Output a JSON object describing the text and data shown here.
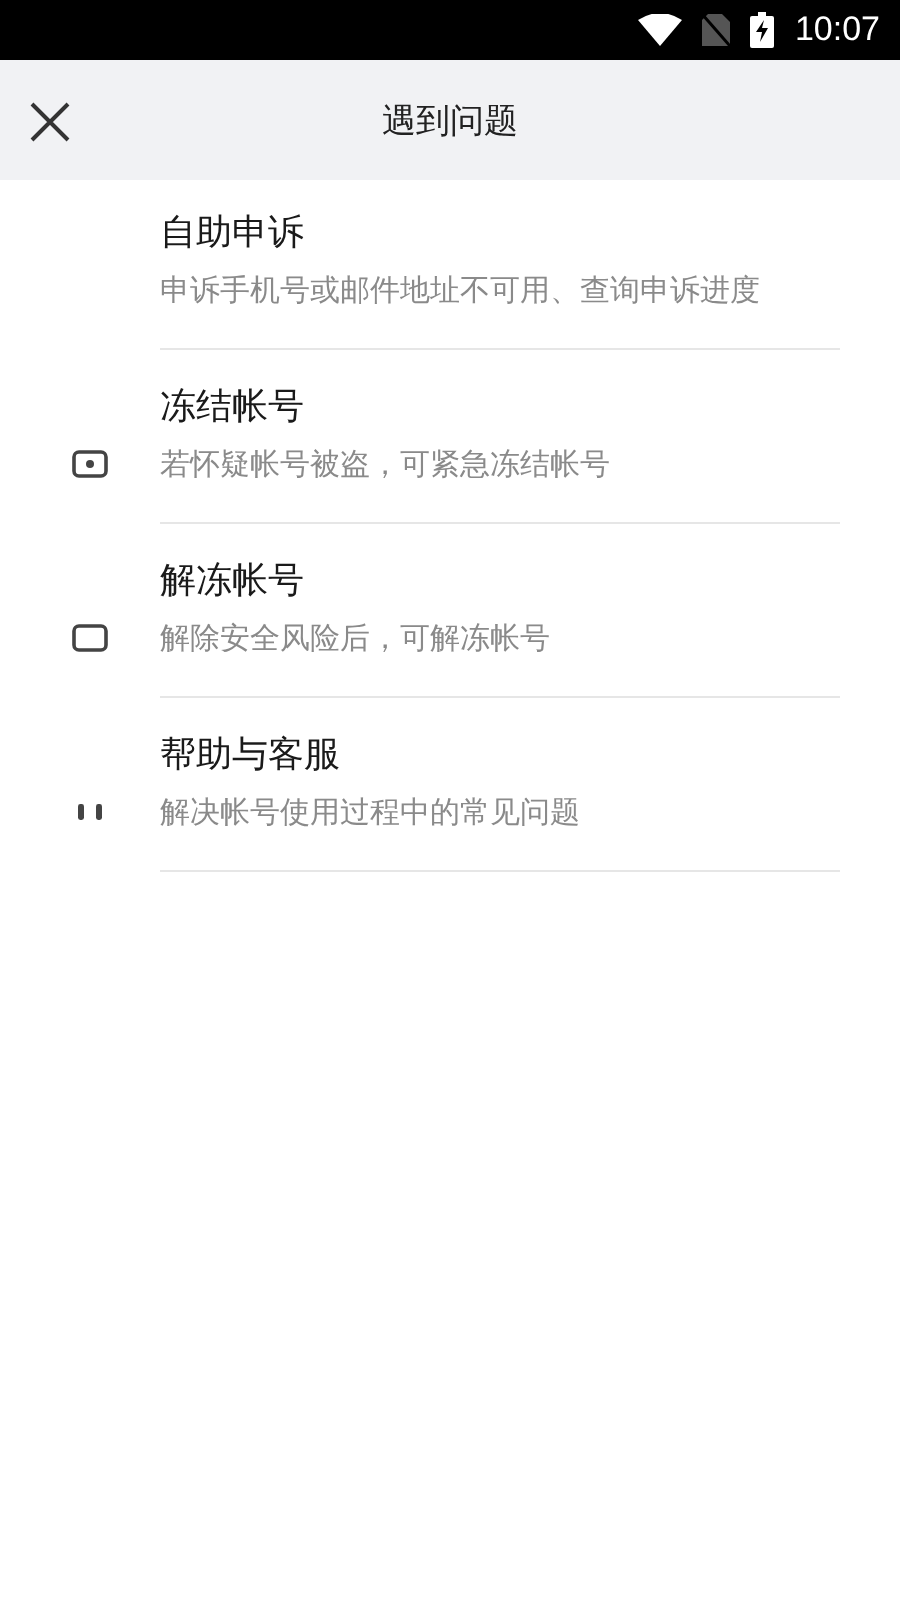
{
  "status_bar": {
    "time": "10:07"
  },
  "header": {
    "title": "遇到问题"
  },
  "items": [
    {
      "kind": "none",
      "title": "自助申诉",
      "subtitle": "申诉手机号或邮件地址不可用、查询申诉进度"
    },
    {
      "kind": "dot-square",
      "title": "冻结帐号",
      "subtitle": "若怀疑帐号被盗，可紧急冻结帐号"
    },
    {
      "kind": "square",
      "title": "解冻帐号",
      "subtitle": "解除安全风险后，可解冻帐号"
    },
    {
      "kind": "two-dots",
      "title": "帮助与客服",
      "subtitle": "解决帐号使用过程中的常见问题"
    }
  ]
}
